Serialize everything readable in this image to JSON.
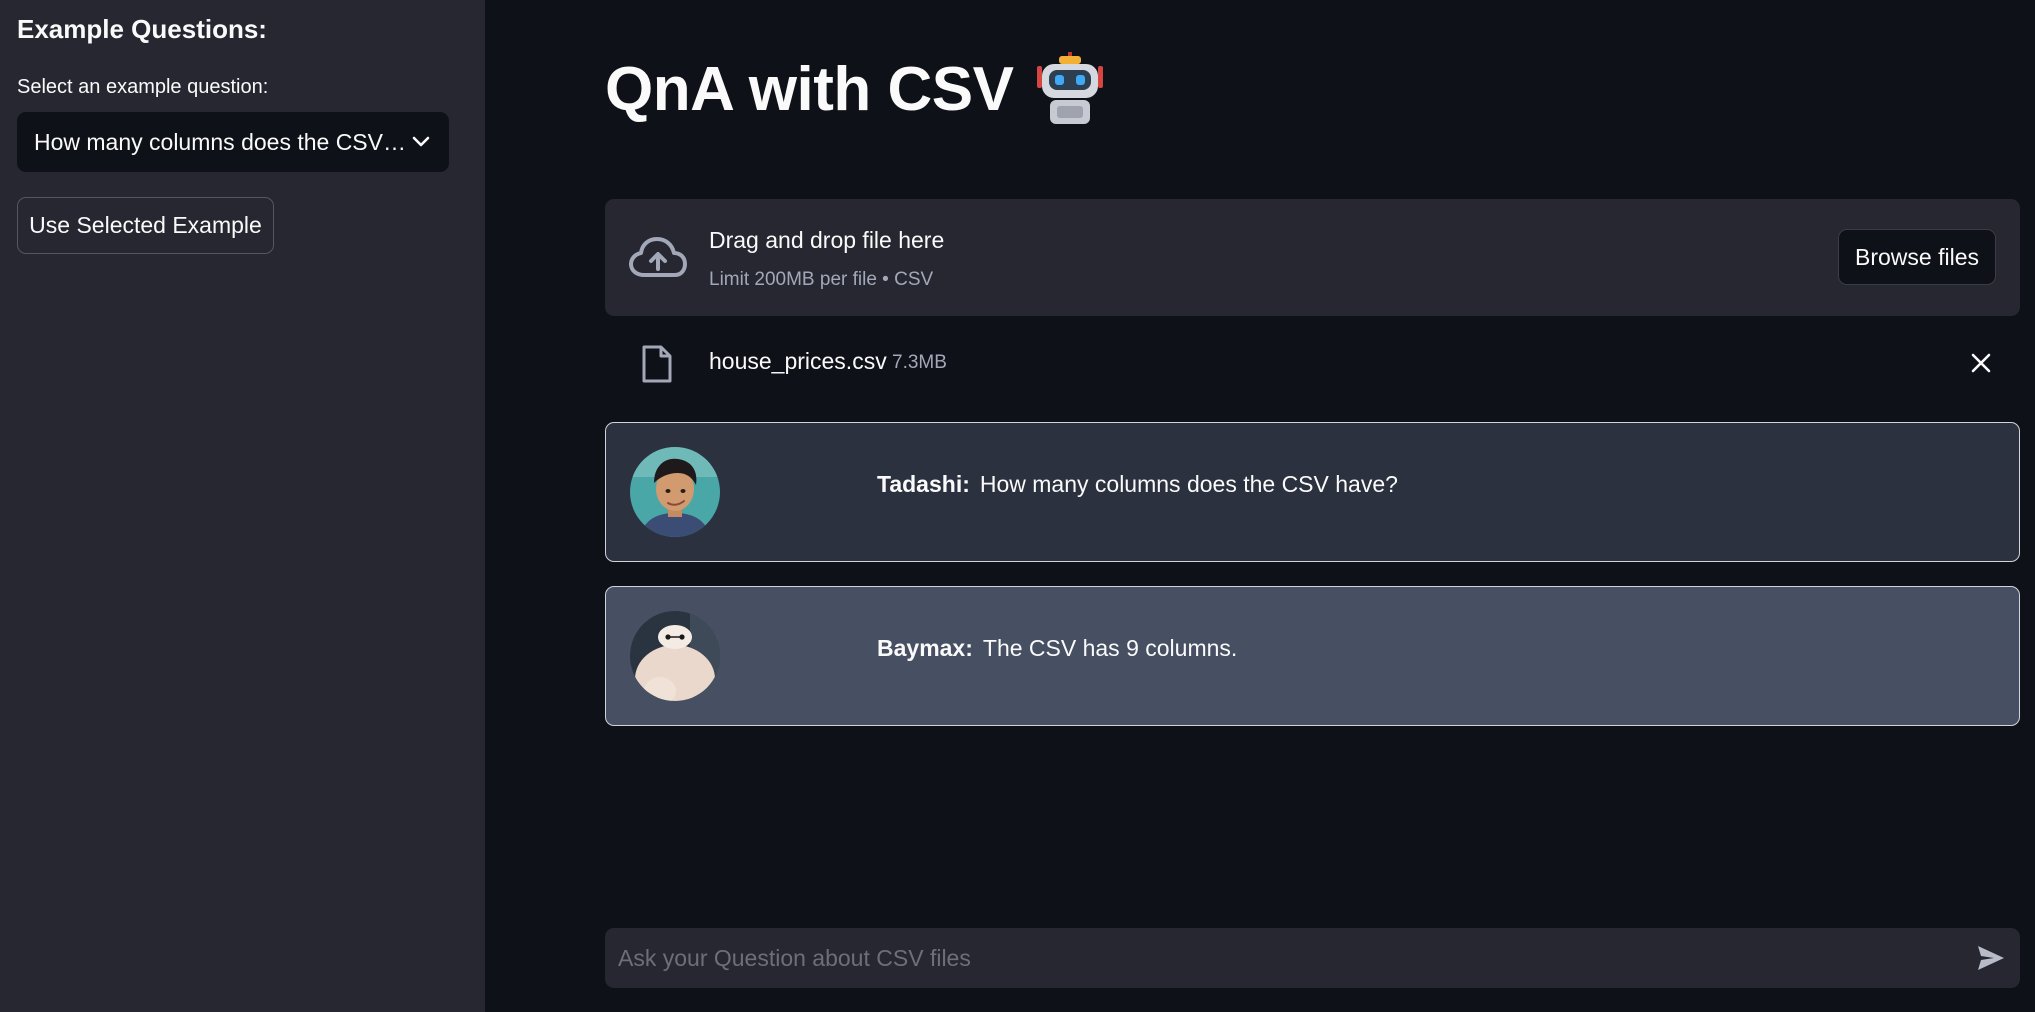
{
  "sidebar": {
    "heading": "Example Questions:",
    "select_label": "Select an example question:",
    "select_value": "How many columns does the CSV have?",
    "use_button": "Use Selected Example"
  },
  "main": {
    "title": "QnA with CSV",
    "title_icon": "robot-icon"
  },
  "uploader": {
    "title": "Drag and drop file here",
    "subtitle": "Limit 200MB per file • CSV",
    "browse_label": "Browse files",
    "file": {
      "name": "house_prices.csv",
      "size": "7.3MB"
    }
  },
  "chat": {
    "messages": [
      {
        "speaker": "Tadashi:",
        "text": "How many columns does the CSV have?",
        "avatar": "tadashi-avatar"
      },
      {
        "speaker": "Baymax:",
        "text": "The CSV has 9 columns.",
        "avatar": "baymax-avatar"
      }
    ],
    "input_placeholder": "Ask your Question about CSV files"
  },
  "colors": {
    "app_bg": "#0e1117",
    "sidebar_bg": "#262730",
    "user_msg_bg": "#2b313e",
    "bot_msg_bg": "#475063"
  }
}
